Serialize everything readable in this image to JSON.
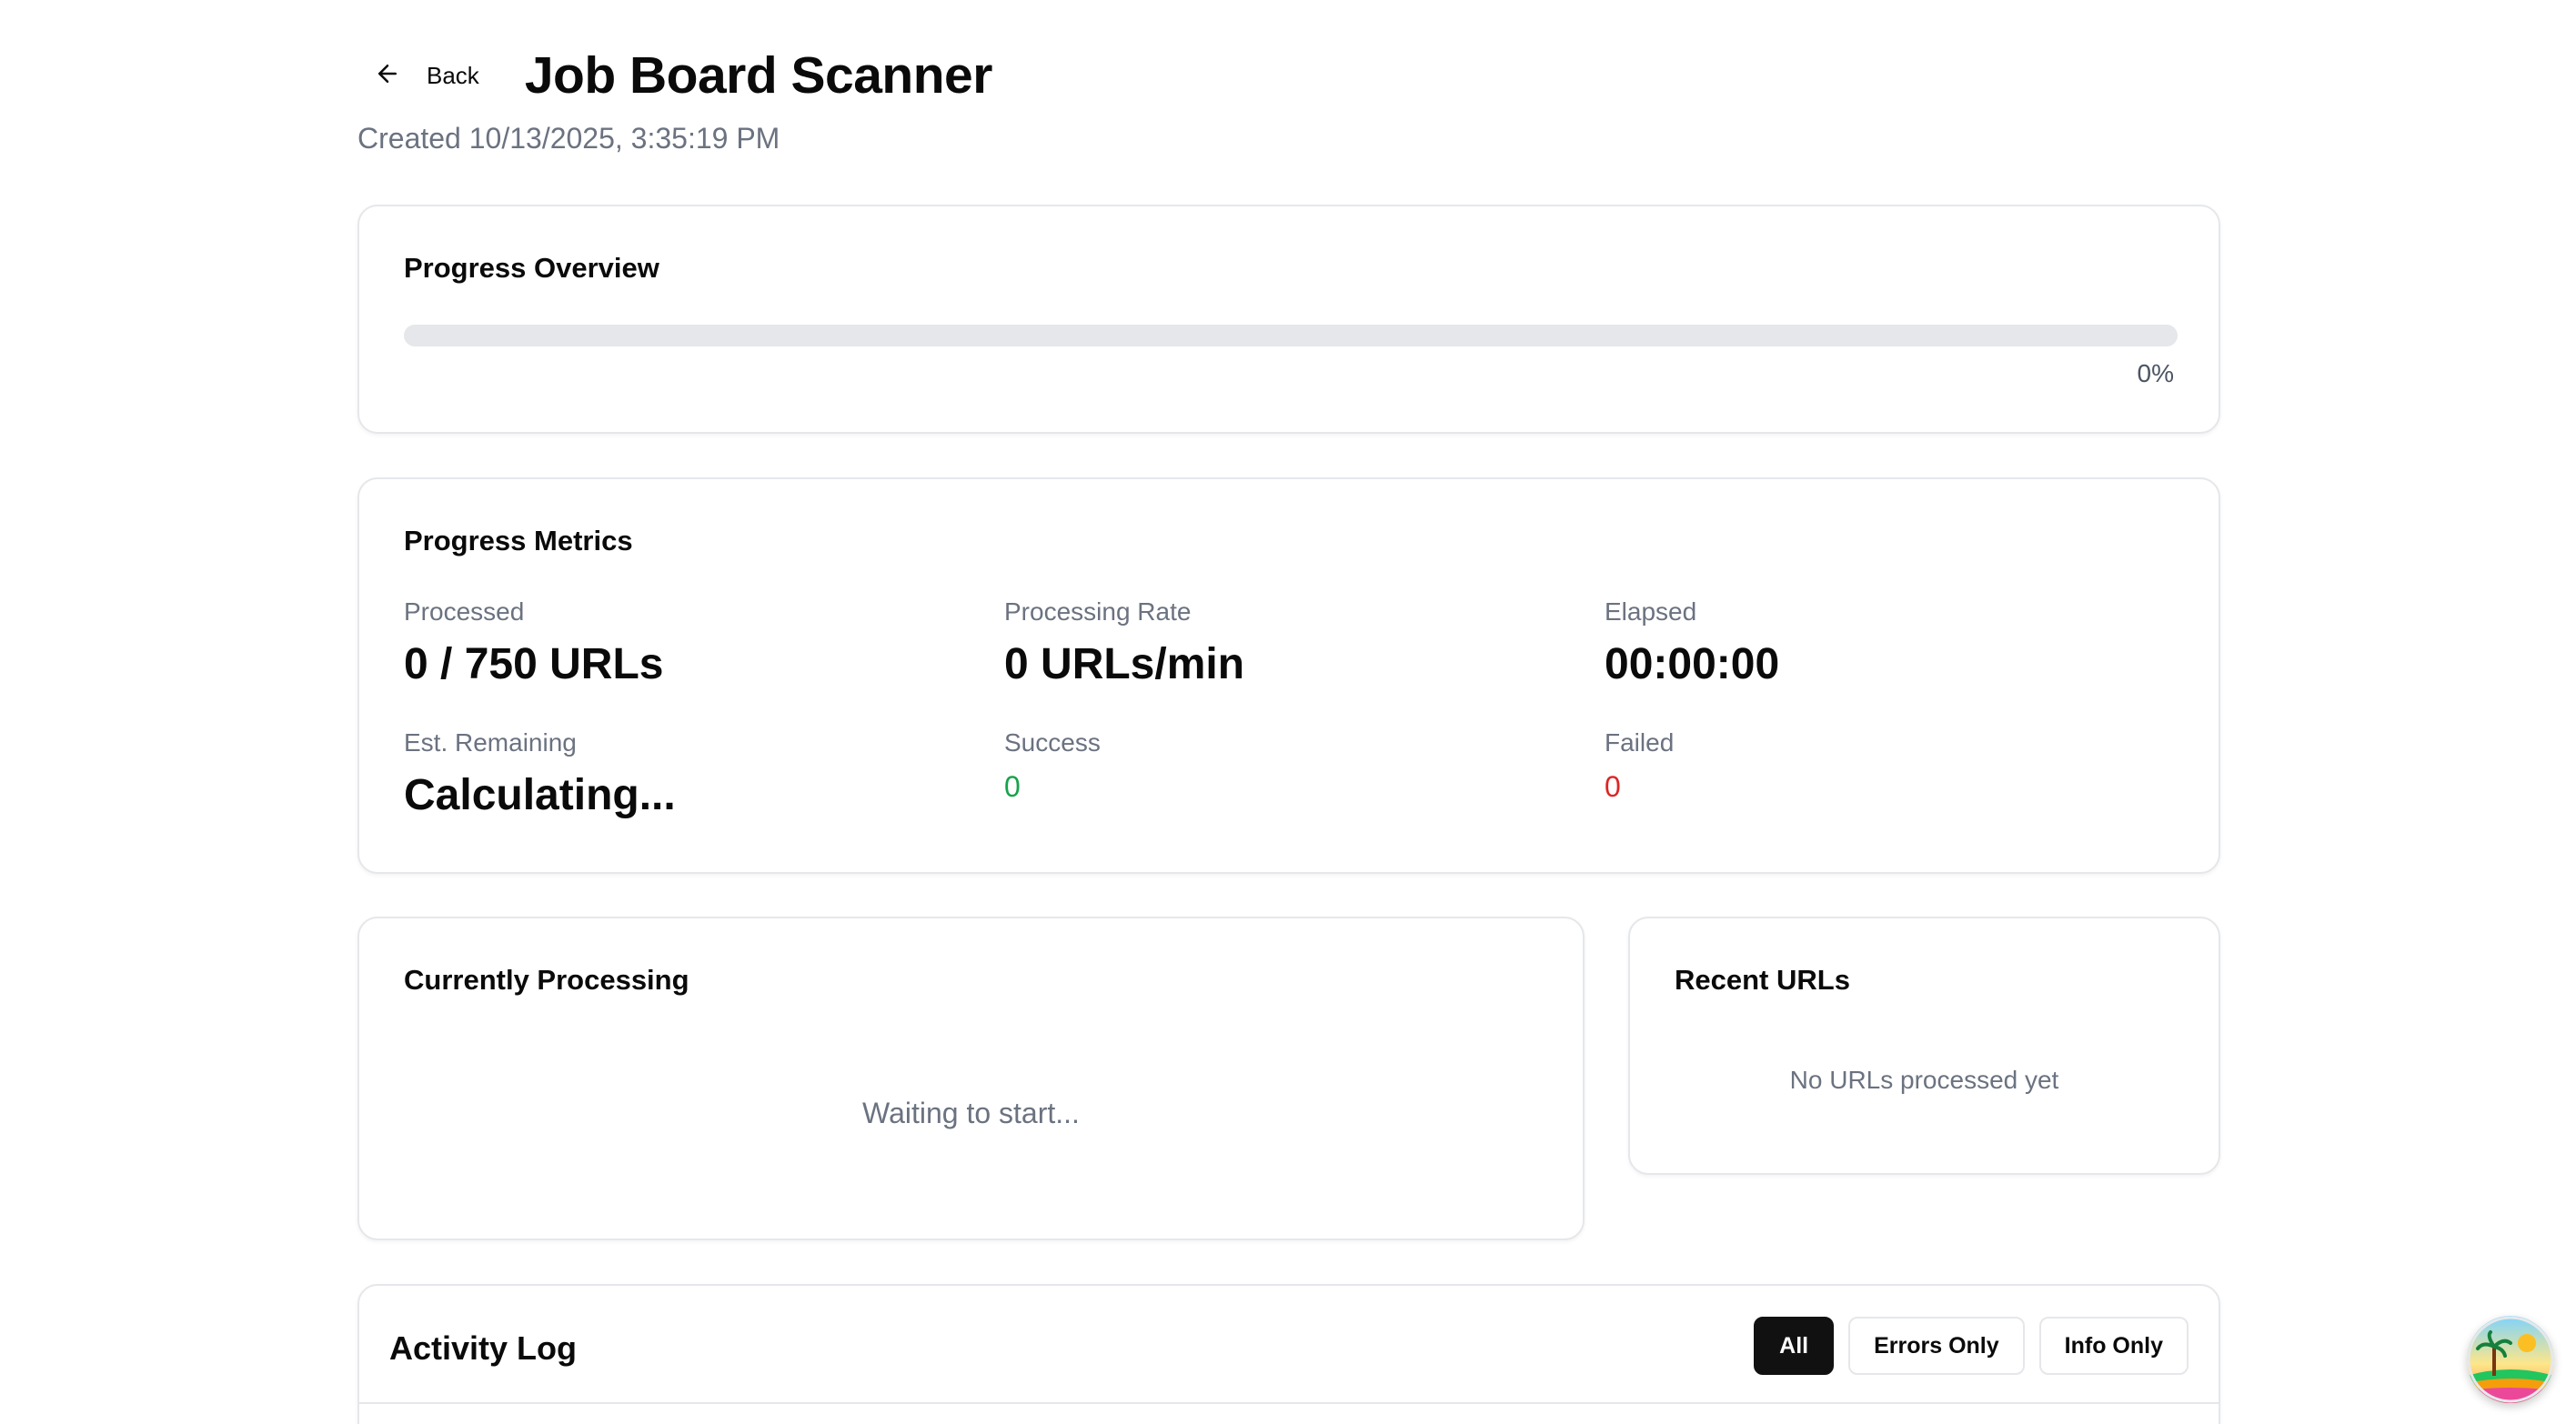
{
  "header": {
    "back_label": "Back",
    "title": "Job Board Scanner",
    "created": "Created 10/13/2025, 3:35:19 PM"
  },
  "overview": {
    "title": "Progress Overview",
    "percent_text": "0%",
    "progress_fraction": 0
  },
  "metrics": {
    "title": "Progress Metrics",
    "processed": {
      "label": "Processed",
      "value": "0 / 750 URLs"
    },
    "rate": {
      "label": "Processing Rate",
      "value": "0 URLs/min"
    },
    "elapsed": {
      "label": "Elapsed",
      "value": "00:00:00"
    },
    "remaining": {
      "label": "Est. Remaining",
      "value": "Calculating..."
    },
    "success": {
      "label": "Success",
      "value": "0"
    },
    "failed": {
      "label": "Failed",
      "value": "0"
    }
  },
  "current": {
    "title": "Currently Processing",
    "empty_text": "Waiting to start..."
  },
  "recent": {
    "title": "Recent URLs",
    "empty_text": "No URLs processed yet"
  },
  "activity": {
    "title": "Activity Log",
    "filters": [
      "All",
      "Errors Only",
      "Info Only"
    ],
    "active_filter": "All"
  },
  "colors": {
    "success": "#16a34a",
    "failed": "#dc2626",
    "active_filter_bg": "#111111",
    "muted_text": "#6b7280"
  },
  "icons": {
    "back": "arrow-left-icon",
    "floating": "beach-avatar-icon"
  }
}
